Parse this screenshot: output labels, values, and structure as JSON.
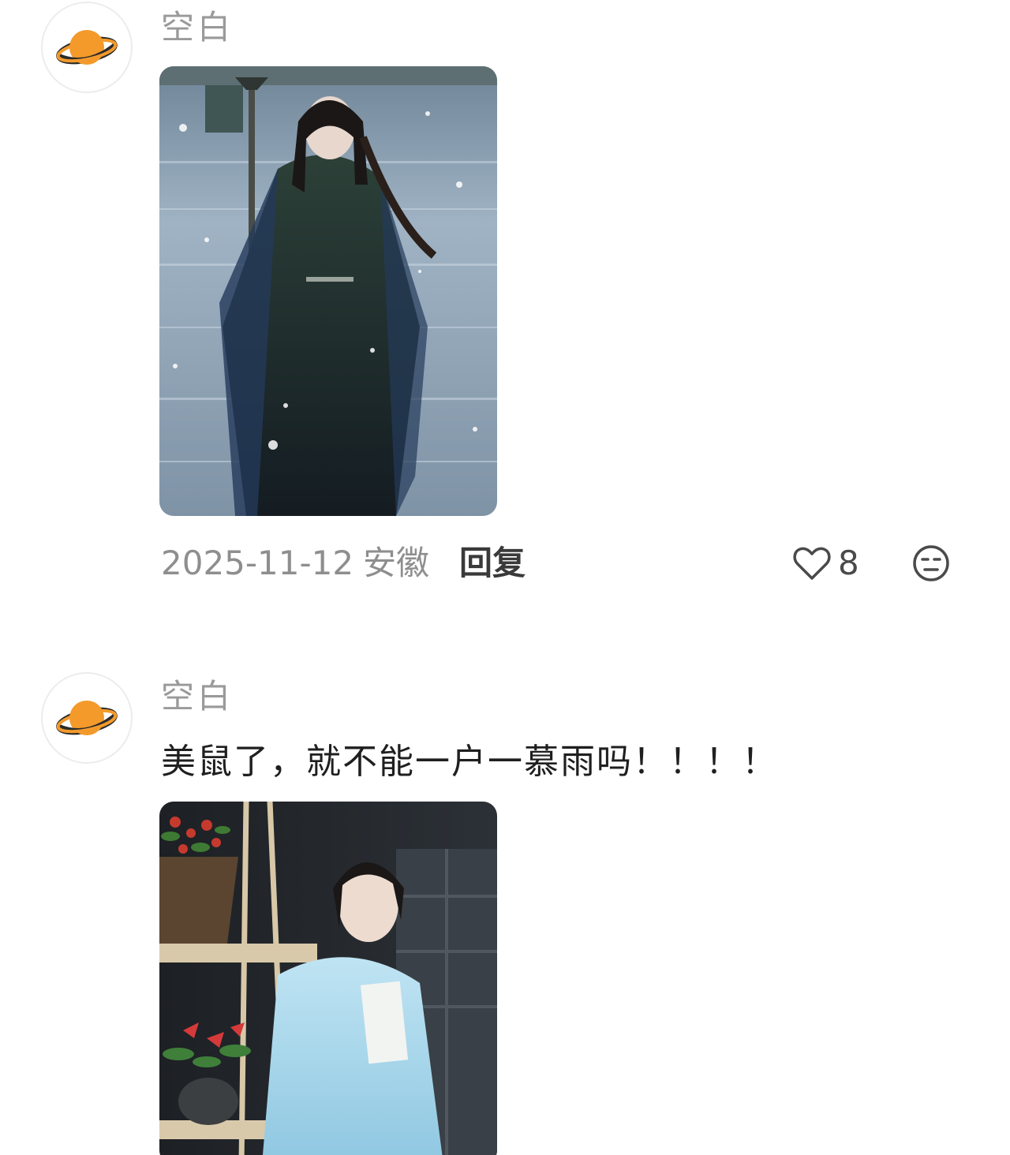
{
  "comments": [
    {
      "username": "空白",
      "text": "",
      "date": "2025-11-12",
      "region": "安徽",
      "reply_label": "回复",
      "like_count": "8",
      "avatar_icon": "planet-icon",
      "photo_alt": "photo-attachment"
    },
    {
      "username": "空白",
      "text": "美鼠了，就不能一户一慕雨吗！！！！",
      "avatar_icon": "planet-icon",
      "photo_alt": "photo-attachment"
    }
  ],
  "icons": {
    "like": "heart-outline-icon",
    "dislike": "meh-face-icon",
    "avatar": "planet-icon"
  },
  "colors": {
    "avatar_planet": "#f39a2b",
    "avatar_ring": "#2b2b2b",
    "text_primary": "#1f1f1f",
    "text_secondary": "#9a9a9a"
  }
}
